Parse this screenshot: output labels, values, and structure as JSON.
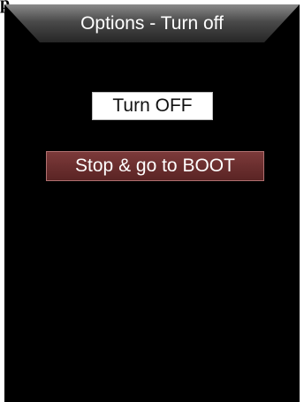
{
  "header_fragment": "p",
  "title": "Options - Turn off",
  "buttons": {
    "turn_off_label": "Turn OFF",
    "stop_boot_label": "Stop & go to BOOT"
  },
  "colors": {
    "screen_bg": "#000000",
    "title_bar": "#3a3a3a",
    "turn_off_bg": "#ffffff",
    "stop_boot_bg": "#6b2f2f"
  }
}
